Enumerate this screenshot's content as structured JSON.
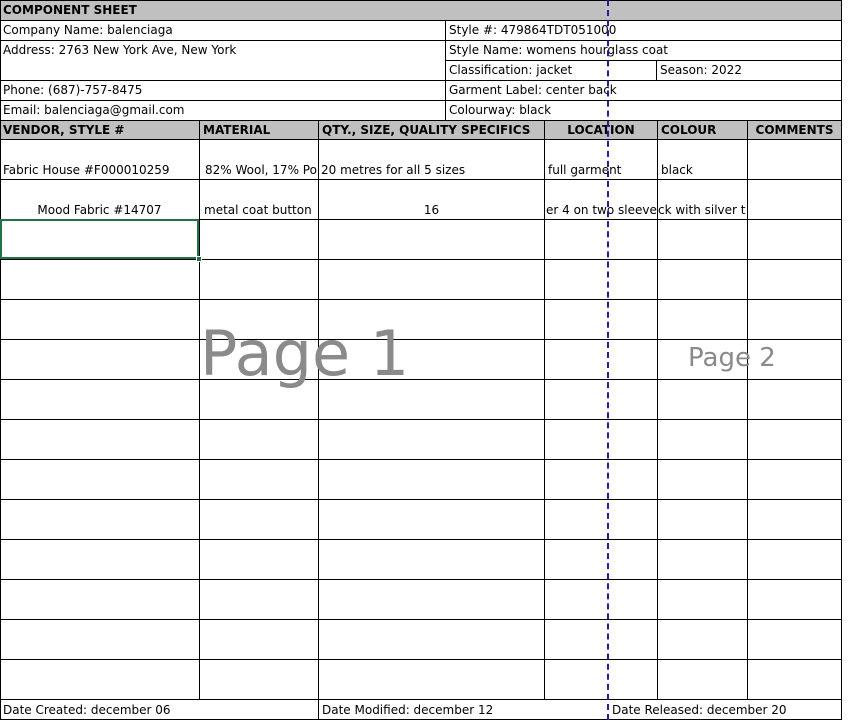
{
  "sheet": {
    "title": "COMPONENT SHEET",
    "company": "Company Name: balenciaga",
    "style_no": "Style #: 479864TDT051000",
    "address": "Address: 2763 New York Ave, New York",
    "style_name": "Style Name: womens hourglass coat",
    "classification": "Classification: jacket",
    "season": "Season: 2022",
    "phone": "Phone:  (687)-757-8475",
    "garment_label": "Garment Label: center back",
    "email": "Email: balenciaga@gmail.com",
    "colourway": "Colourway: black"
  },
  "table": {
    "headers": [
      "VENDOR, STYLE #",
      "MATERIAL",
      "QTY., SIZE, QUALITY SPECIFICS",
      "LOCATION",
      "COLOUR",
      "COMMENTS"
    ],
    "rows": [
      [
        "Fabric House #F000010259",
        "82% Wool, 17% Po",
        "20 metres for all 5 sizes",
        "full garment",
        "black",
        ""
      ],
      [
        "Mood Fabric #14707",
        "metal coat button",
        "16",
        "er 4 on two sleeve",
        "ck with silver t",
        ""
      ]
    ]
  },
  "footer": {
    "created": "Date Created: december 06",
    "modified": "Date Modified: december 12",
    "released": "Date Released: december 20"
  },
  "watermarks": {
    "page1": "Page 1",
    "page2": "Page 2"
  },
  "colors": {
    "header_fill": "#c0c0c0",
    "selection": "#217346",
    "page_break": "#1f1fa3",
    "watermark": "#8a8a8a"
  }
}
